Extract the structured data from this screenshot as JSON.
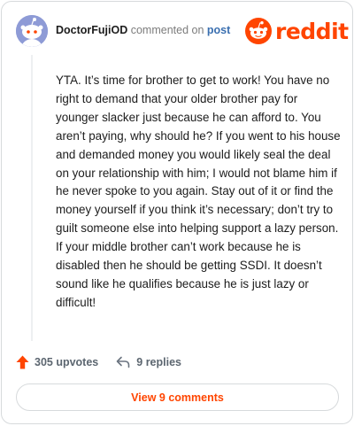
{
  "header": {
    "username": "DoctorFujiOD",
    "action_text": "commented on",
    "link_text": "post"
  },
  "logo": {
    "wordmark": "reddit",
    "icon": "reddit-snoo-icon",
    "color": "#ff4500"
  },
  "avatar": {
    "icon": "snoo-avatar-icon",
    "color": "#8e9bd6"
  },
  "comment": {
    "body": "YTA. It’s time for brother to get to work! You have no right to demand that your older brother pay for younger slacker just because he can afford to. You aren’t paying, why should he? If you went to his house and demanded money you would likely seal the deal on your relationship with him; I would not blame him if he never spoke to you again. Stay out of it or find the money yourself if you think it’s necessary; don’t try to guilt someone else into helping support a lazy person. If your middle brother can’t work because he is disabled then he should be getting SSDI. It doesn’t sound like he qualifies because he is just lazy or difficult!"
  },
  "actions": {
    "upvotes": "305 upvotes",
    "upvote_icon": "upvote-arrow-icon",
    "replies": "9 replies",
    "reply_icon": "reply-arrow-icon"
  },
  "view_button": {
    "label": "View 9 comments"
  },
  "colors": {
    "accent": "#ff4500",
    "text": "#1c1c1c",
    "muted": "#7c7c7c",
    "link": "#3a6fb0"
  }
}
